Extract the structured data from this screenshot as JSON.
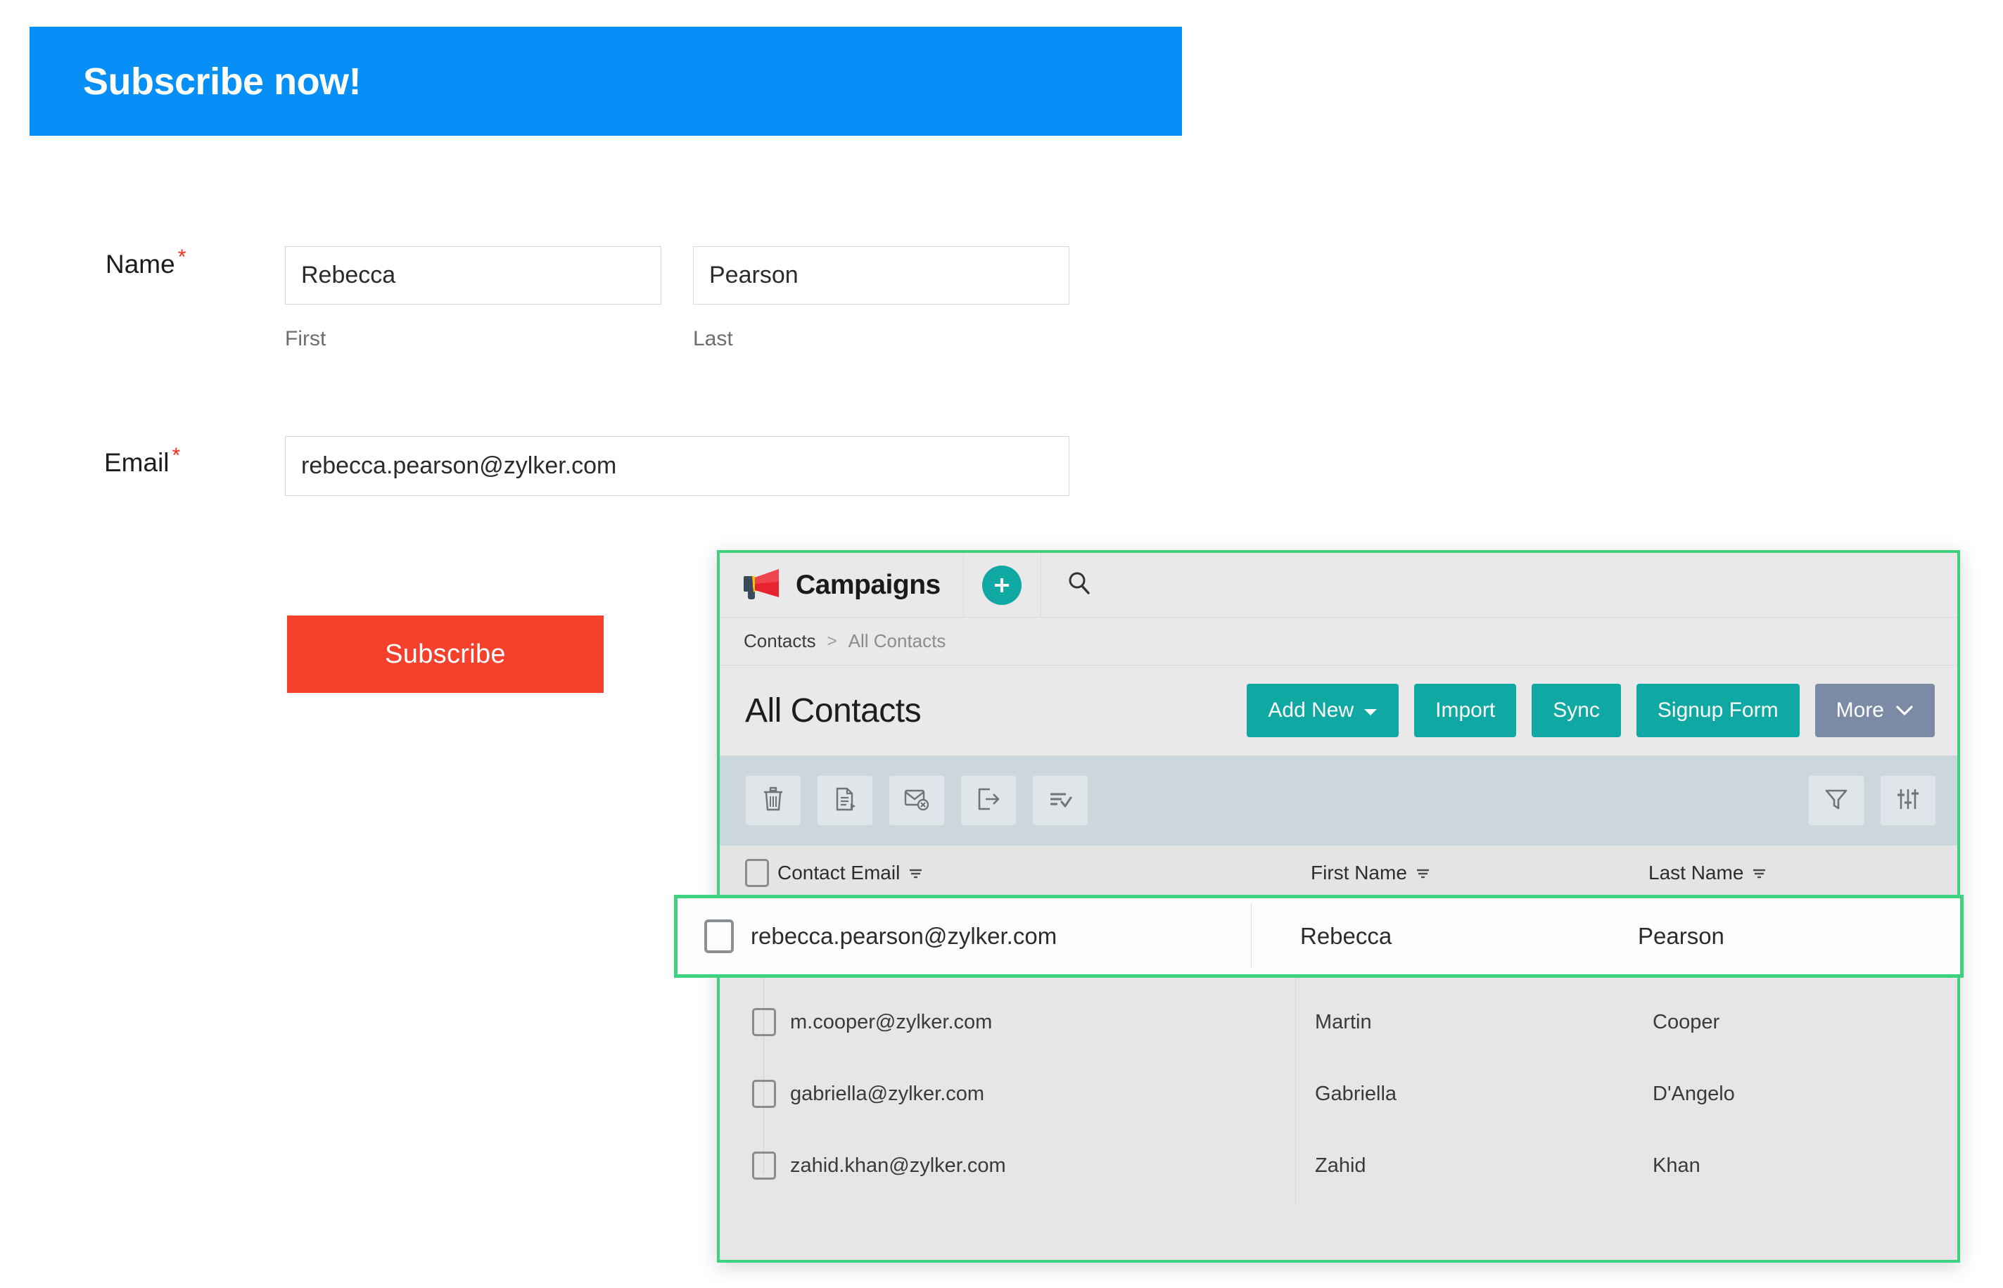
{
  "form": {
    "header_title": "Subscribe now!",
    "header_color": "#0690f7",
    "name_label": "Name",
    "required_mark": "*",
    "first_value": "Rebecca",
    "last_value": "Pearson",
    "first_sublabel": "First",
    "last_sublabel": "Last",
    "email_label": "Email",
    "email_value": "rebecca.pearson@zylker.com",
    "first_placeholder": "First",
    "last_placeholder": "Last",
    "email_placeholder": "Email",
    "submit_label": "Subscribe",
    "submit_color": "#f5402c"
  },
  "campaigns": {
    "brand_name": "Campaigns",
    "brand_logo_icon": "megaphone-icon",
    "add_icon": "plus-icon",
    "search_icon": "search-icon",
    "accent_color": "#0fa8a3",
    "panel_border_color": "#3ed17f",
    "breadcrumb": {
      "root": "Contacts",
      "separator": ">",
      "current": "All Contacts"
    },
    "page_title": "All Contacts",
    "actions": [
      {
        "label": "Add New",
        "icon": "caret-down-icon",
        "style": "teal"
      },
      {
        "label": "Import",
        "icon": "",
        "style": "teal"
      },
      {
        "label": "Sync",
        "icon": "",
        "style": "teal"
      },
      {
        "label": "Signup Form",
        "icon": "",
        "style": "teal"
      },
      {
        "label": "More",
        "icon": "chevron-down-icon",
        "style": "gray"
      }
    ],
    "toolbar_left_icons": [
      "trash-icon",
      "copy-to-list-icon",
      "unsubscribe-envelope-icon",
      "export-icon",
      "select-list-icon"
    ],
    "toolbar_right_icons": [
      "filter-funnel-icon",
      "settings-sliders-icon"
    ],
    "table": {
      "select_all_icon": "checkbox-icon",
      "sort_icon": "sort-icon",
      "columns": [
        {
          "label": "Contact Email"
        },
        {
          "label": "First Name"
        },
        {
          "label": "Last Name"
        }
      ],
      "highlighted_row": {
        "email": "rebecca.pearson@zylker.com",
        "first_name": "Rebecca",
        "last_name": "Pearson"
      },
      "rows": [
        {
          "email": "m.cooper@zylker.com",
          "first_name": "Martin",
          "last_name": "Cooper"
        },
        {
          "email": "gabriella@zylker.com",
          "first_name": "Gabriella",
          "last_name": "D'Angelo"
        },
        {
          "email": "zahid.khan@zylker.com",
          "first_name": "Zahid",
          "last_name": "Khan"
        }
      ]
    }
  }
}
